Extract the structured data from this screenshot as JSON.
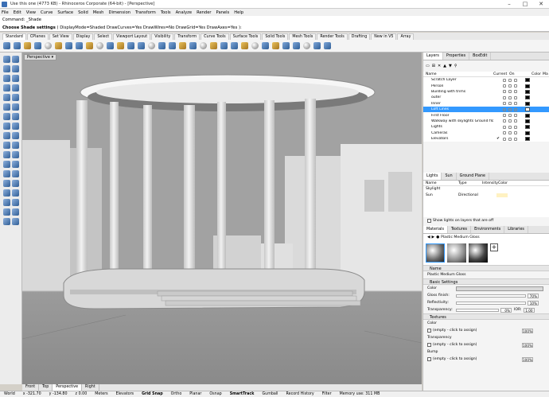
{
  "window": {
    "title": "Use this one (4773 KB) - Rhinoceros Corporate (64-bit) - [Perspective]"
  },
  "menu": [
    "File",
    "Edit",
    "View",
    "Curve",
    "Surface",
    "Solid",
    "Mesh",
    "Dimension",
    "Transform",
    "Tools",
    "Analyze",
    "Render",
    "Panels",
    "Help"
  ],
  "command": {
    "history": "Command: _Shade",
    "prompt": "Choose Shade settings",
    "options": "( DisplayMode=Shaded  DrawCurves=Yes  DrawWires=No  DrawGrid=Yes  DrawAxes=Yes ):"
  },
  "toolbar_tabs": [
    "Standard",
    "CPlanes",
    "Set View",
    "Display",
    "Select",
    "Viewport Layout",
    "Visibility",
    "Transform",
    "Curve Tools",
    "Surface Tools",
    "Solid Tools",
    "Mesh Tools",
    "Render Tools",
    "Drafting",
    "New in V5",
    "Array"
  ],
  "viewport": {
    "label": "Perspective",
    "tabs": [
      "Front",
      "Top",
      "Perspective",
      "Right"
    ],
    "active_tab": "Perspective"
  },
  "layers_panel": {
    "tabs": [
      "Layers",
      "Properties",
      "BoxEdit"
    ],
    "columns": {
      "name": "Name",
      "current": "Current",
      "on": "On",
      "color": "Color",
      "material": "Ma"
    },
    "rows": [
      {
        "name": "Scratch Layer",
        "current": "",
        "color": "#000000"
      },
      {
        "name": "Person",
        "current": "",
        "color": "#000000"
      },
      {
        "name": "Building with trims",
        "current": "",
        "color": "#000000"
      },
      {
        "name": "outer",
        "current": "",
        "color": "#000000"
      },
      {
        "name": "Inner",
        "current": "",
        "color": "#000000"
      },
      {
        "name": "Loft Lines",
        "current": "",
        "color": "#ffffff",
        "selected": true
      },
      {
        "name": "First Floor",
        "current": "",
        "color": "#000000"
      },
      {
        "name": "Walkway with skylights Ground floor",
        "current": "",
        "color": "#000000"
      },
      {
        "name": "Lights",
        "current": "",
        "color": "#000000"
      },
      {
        "name": "Cameras",
        "current": "",
        "color": "#000000"
      },
      {
        "name": "Elevators",
        "current": "✔",
        "color": "#000000"
      }
    ]
  },
  "lights_panel": {
    "tabs": [
      "Lights",
      "Sun",
      "Ground Plane"
    ],
    "columns": [
      "Name",
      "Type",
      "Intensity",
      "Color"
    ],
    "rows": [
      {
        "name": "Skylight",
        "type": "",
        "intensity": ""
      },
      {
        "name": "Sun",
        "type": "Directional",
        "intensity": ""
      }
    ],
    "checkbox_label": "Show lights on layers that are off"
  },
  "materials_panel": {
    "tabs": [
      "Materials",
      "Textures",
      "Environments",
      "Libraries"
    ],
    "current": "Plastic Medium Gloss",
    "name_section": "Name",
    "name_value": "Plastic Medium Gloss",
    "basic_section": "Basic Settings",
    "color_label": "Color",
    "gloss_label": "Gloss finish:",
    "gloss_ticks": [
      "0%",
      "70%",
      "100%"
    ],
    "gloss_value": "70%",
    "reflectivity_label": "Reflectivity:",
    "reflectivity_ticks": [
      "0%",
      "10%",
      "100%"
    ],
    "reflectivity_value": "10%",
    "transparency_label": "Transparency:",
    "transparency_value": "0%",
    "ior_label": "IOR:",
    "ior_value": "1.00",
    "textures_section": "Textures",
    "tex_color": "Color",
    "tex_transparency": "Transparency",
    "tex_bump": "Bump",
    "tex_empty": "(empty - click to assign)",
    "tex_pct": "100%"
  },
  "status": {
    "cplane": "World",
    "x": "x -321.70",
    "y": "y -134.80",
    "z": "z 0.00",
    "units": "Meters",
    "layer": "Elevators",
    "toggles": [
      "Grid Snap",
      "Ortho",
      "Planar",
      "Osnap",
      "SmartTrack",
      "Gumball",
      "Record History",
      "Filter"
    ],
    "memory": "Memory use: 311 MB"
  },
  "colors": {
    "accent": "#3399ff",
    "viewport_bg": "#a3a3a3"
  }
}
